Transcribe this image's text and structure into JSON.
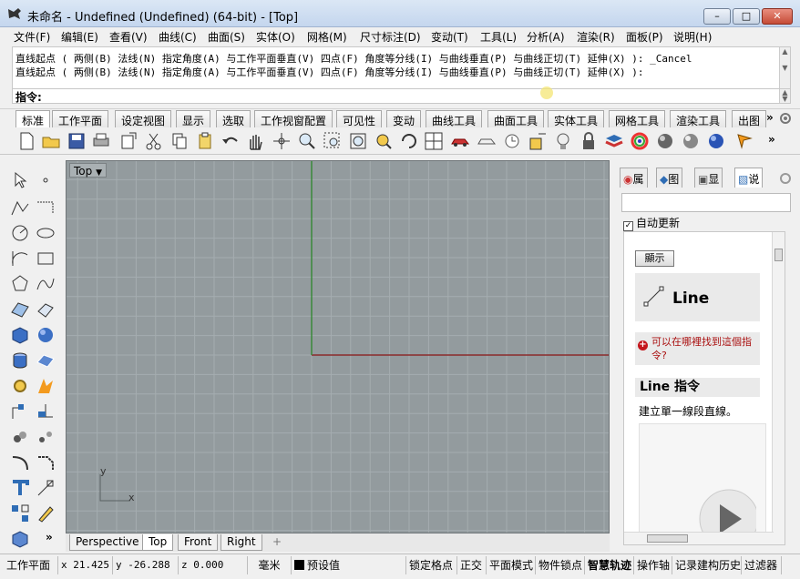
{
  "window": {
    "title": "未命名 - Undefined (Undefined) (64-bit) - [Top]",
    "minimize": "–",
    "maximize": "□",
    "close": "✕"
  },
  "menubar": [
    "文件(F)",
    "编辑(E)",
    "查看(V)",
    "曲线(C)",
    "曲面(S)",
    "实体(O)",
    "网格(M)",
    "尺寸标注(D)",
    "变动(T)",
    "工具(L)",
    "分析(A)",
    "渲染(R)",
    "面板(P)",
    "说明(H)"
  ],
  "command": {
    "history": [
      "直线起点 ( 两侧(B)  法线(N)  指定角度(A)  与工作平面垂直(V)  四点(F)  角度等分线(I)  与曲线垂直(P)  与曲线正切(T)  延伸(X) ): _Cancel",
      "直线起点 ( 两侧(B)  法线(N)  指定角度(A)  与工作平面垂直(V)  四点(F)  角度等分线(I)  与曲线垂直(P)  与曲线正切(T)  延伸(X) ):"
    ],
    "prompt": "指令:"
  },
  "toolbar_tabs": [
    "标准",
    "工作平面",
    "设定视图",
    "显示",
    "选取",
    "工作视窗配置",
    "可见性",
    "变动",
    "曲线工具",
    "曲面工具",
    "实体工具",
    "网格工具",
    "渲染工具",
    "出图"
  ],
  "toolbar_more": "»",
  "viewport": {
    "label": "Top",
    "axis_x": "x",
    "axis_y": "y",
    "tabs": [
      "Perspective",
      "Top",
      "Front",
      "Right"
    ],
    "add_tab": "+"
  },
  "right_panel": {
    "tabs": [
      "属",
      "图",
      "显",
      "说"
    ],
    "auto_update": "自动更新",
    "help": {
      "show_button": "顯示",
      "command_name": "Line",
      "where_text": "可以在哪裡找到這個指令?",
      "heading": "Line 指令",
      "description": "建立單一線段直線。"
    }
  },
  "statusbar": {
    "cplane": "工作平面",
    "x": "x 21.425",
    "y": "y -26.288",
    "z": "z 0.000",
    "units": "毫米",
    "layer": "预设值",
    "toggles": [
      "锁定格点",
      "正交",
      "平面模式",
      "物件锁点",
      "智慧轨迹",
      "操作轴",
      "记录建构历史",
      "过滤器"
    ]
  },
  "colors": {
    "viewport_bg": "#939b9e",
    "grid": "#a5adb0",
    "x_axis": "#8b2a2a",
    "y_axis": "#3a8a3a"
  }
}
